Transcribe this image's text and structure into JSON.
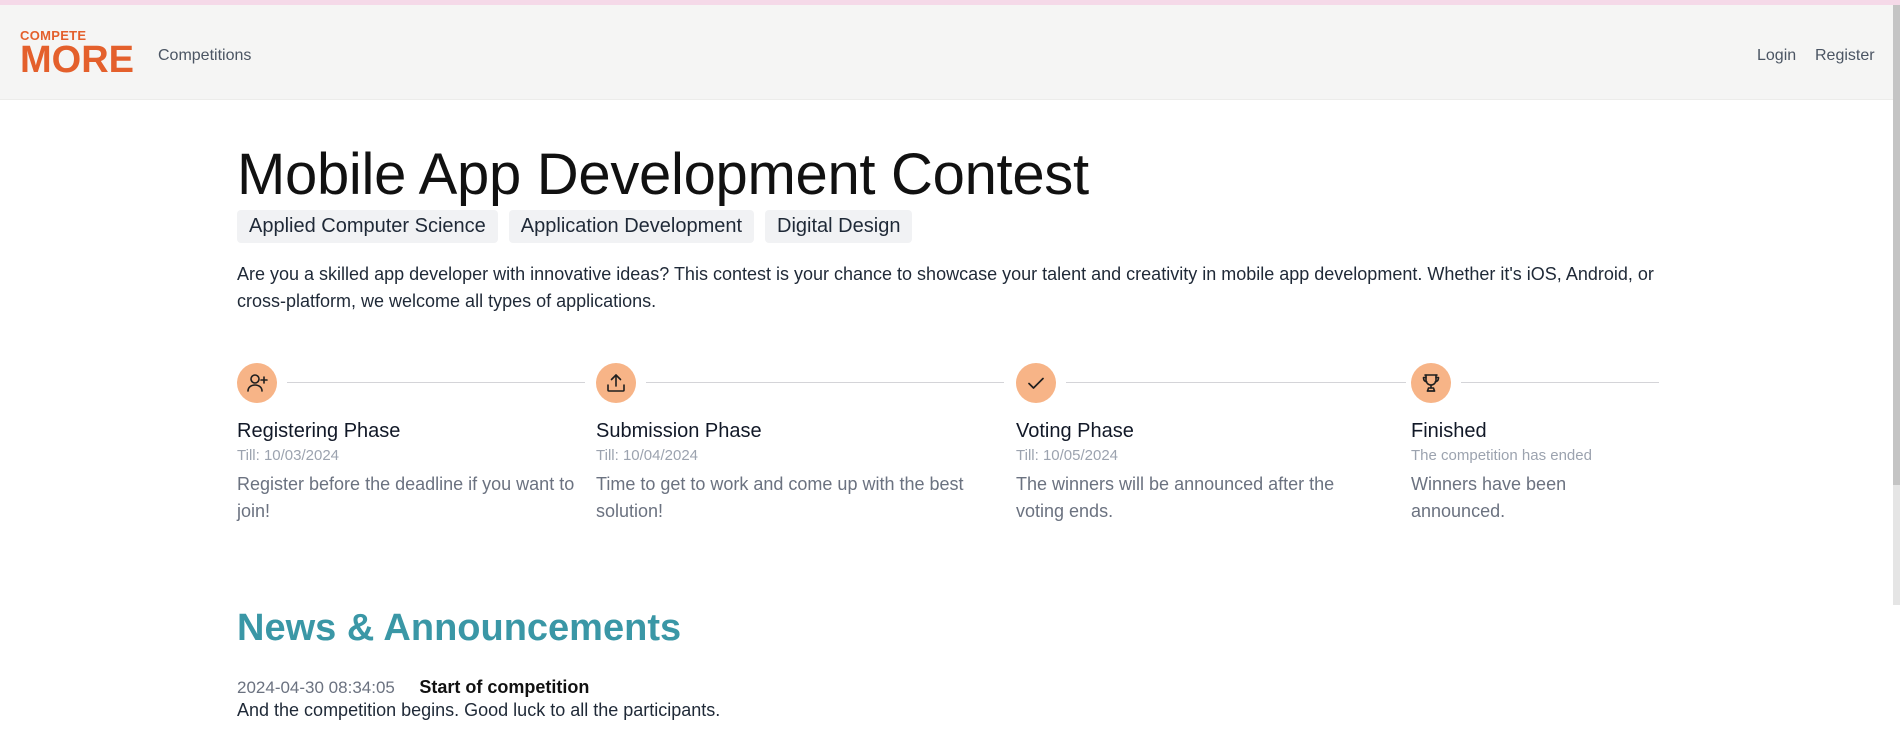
{
  "navbar": {
    "logo_top": "COMPETE",
    "logo_bottom": "MORE",
    "competitions_label": "Competitions",
    "login_label": "Login",
    "register_label": "Register"
  },
  "competition": {
    "title": "Mobile App Development Contest",
    "tags": [
      "Applied Computer Science",
      "Application Development",
      "Digital Design"
    ],
    "description": "Are you a skilled app developer with innovative ideas? This contest is your chance to showcase your talent and creativity in mobile app development. Whether it's iOS, Android, or cross-platform, we welcome all types of applications."
  },
  "phases": [
    {
      "name": "Registering Phase",
      "date": "Till: 10/03/2024",
      "description": "Register before the deadline if you want to join!",
      "icon": "user-plus-icon"
    },
    {
      "name": "Submission Phase",
      "date": "Till: 10/04/2024",
      "description": "Time to get to work and come up with the best solution!",
      "icon": "upload-icon"
    },
    {
      "name": "Voting Phase",
      "date": "Till: 10/05/2024",
      "description": "The winners will be announced after the voting ends.",
      "icon": "check-icon"
    },
    {
      "name": "Finished",
      "date": "The competition has ended",
      "description": "Winners have been announced.",
      "icon": "trophy-icon"
    }
  ],
  "news": {
    "title": "News & Announcements",
    "items": [
      {
        "timestamp": "2024-04-30 08:34:05",
        "heading": "Start of competition",
        "body": "And the competition begins. Good luck to all the participants."
      }
    ]
  },
  "colors": {
    "brand": "#e4602c",
    "phase_icon_bg": "#f7b487",
    "news_title": "#3a97a6"
  }
}
